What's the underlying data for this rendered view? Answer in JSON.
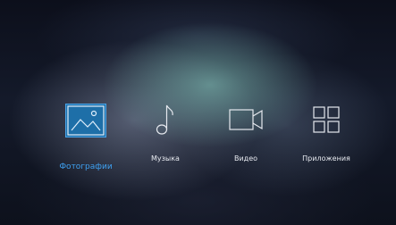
{
  "apps": [
    {
      "label": "Фотографии",
      "icon": "photos-icon",
      "selected": true
    },
    {
      "label": "Музыка",
      "icon": "music-note-icon",
      "selected": false
    },
    {
      "label": "Видео",
      "icon": "video-camera-icon",
      "selected": false
    },
    {
      "label": "Приложения",
      "icon": "apps-grid-icon",
      "selected": false
    }
  ],
  "colors": {
    "accent": "#3ea0f0",
    "selected_tile_fill": "#1e6fa8",
    "icon_stroke": "#e6e9ef"
  }
}
